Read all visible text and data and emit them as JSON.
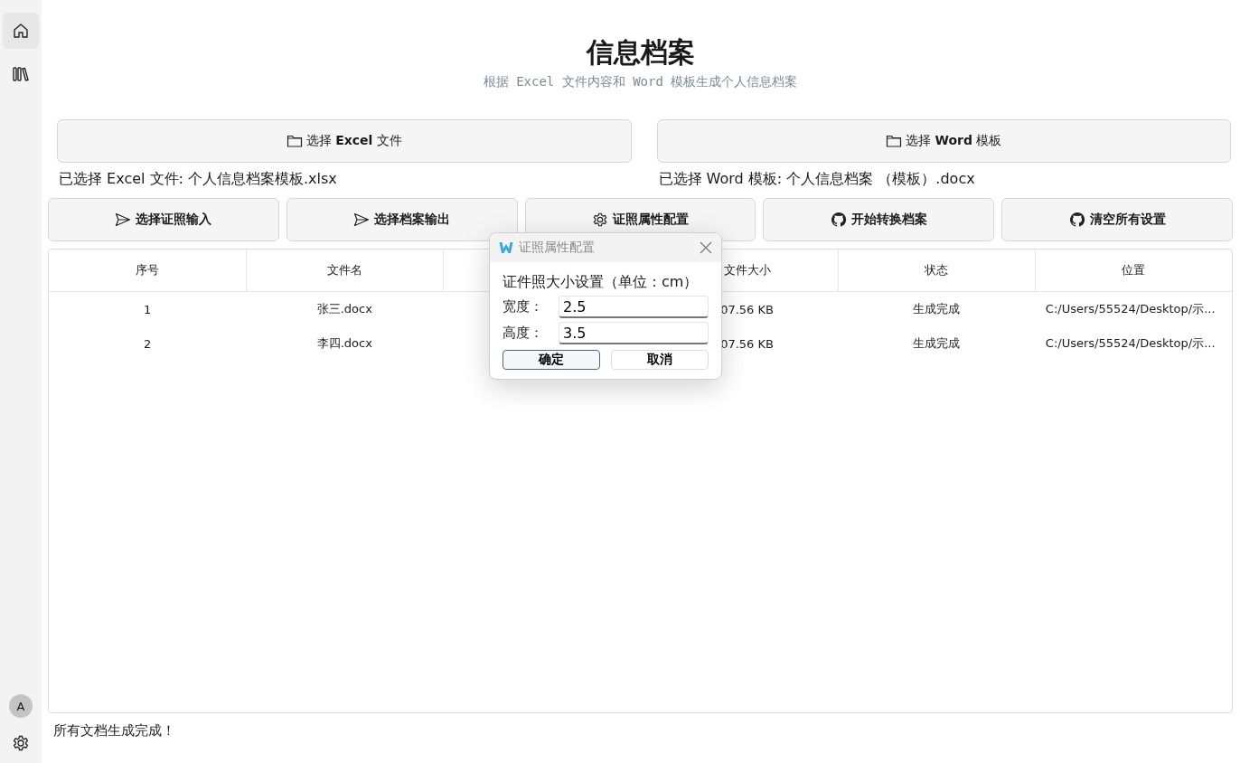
{
  "sidebar": {
    "items": [
      {
        "kind": "home",
        "selected": true
      },
      {
        "kind": "library",
        "selected": false
      }
    ],
    "avatar": "A"
  },
  "header": {
    "title": "信息档案",
    "subtitle": "根据 Excel 文件内容和 Word 模板生成个人信息档案"
  },
  "file_pickers": [
    {
      "label": "选择 **Excel** 文件",
      "selection": "已选择 Excel 文件: 个人信息档案模板.xlsx"
    },
    {
      "label": "选择 **Word** 模板",
      "selection": "已选择 Word 模板: 个人信息档案 （模板）.docx"
    }
  ],
  "actions": [
    {
      "label": "选择证照输入",
      "kind": "send"
    },
    {
      "label": "选择档案输出",
      "kind": "send"
    },
    {
      "label": "证照属性配置",
      "kind": "gear"
    },
    {
      "label": "开始转换档案",
      "kind": "octocat"
    },
    {
      "label": "清空所有设置",
      "kind": "octocat"
    }
  ],
  "table": {
    "columns": [
      "序号",
      "文件名",
      null,
      "文件大小",
      "状态",
      "位置"
    ],
    "rows": [
      [
        "1",
        "张三.docx",
        null,
        "07.56 KB",
        "生成完成",
        "C:/Users/55524/Desktop/示..."
      ],
      [
        "2",
        "李四.docx",
        null,
        "07.56 KB",
        "生成完成",
        "C:/Users/55524/Desktop/示..."
      ]
    ]
  },
  "status_bar": "所有文档生成完成！",
  "dialog": {
    "title": "证照属性配置",
    "heading": "证件照大小设置（单位：cm）",
    "fields": [
      {
        "label": "宽度：",
        "value": "2.5"
      },
      {
        "label": "高度：",
        "value": "3.5"
      }
    ],
    "buttons": [
      {
        "label": "确定",
        "selected": true
      },
      {
        "label": "取消",
        "selected": false
      }
    ]
  }
}
